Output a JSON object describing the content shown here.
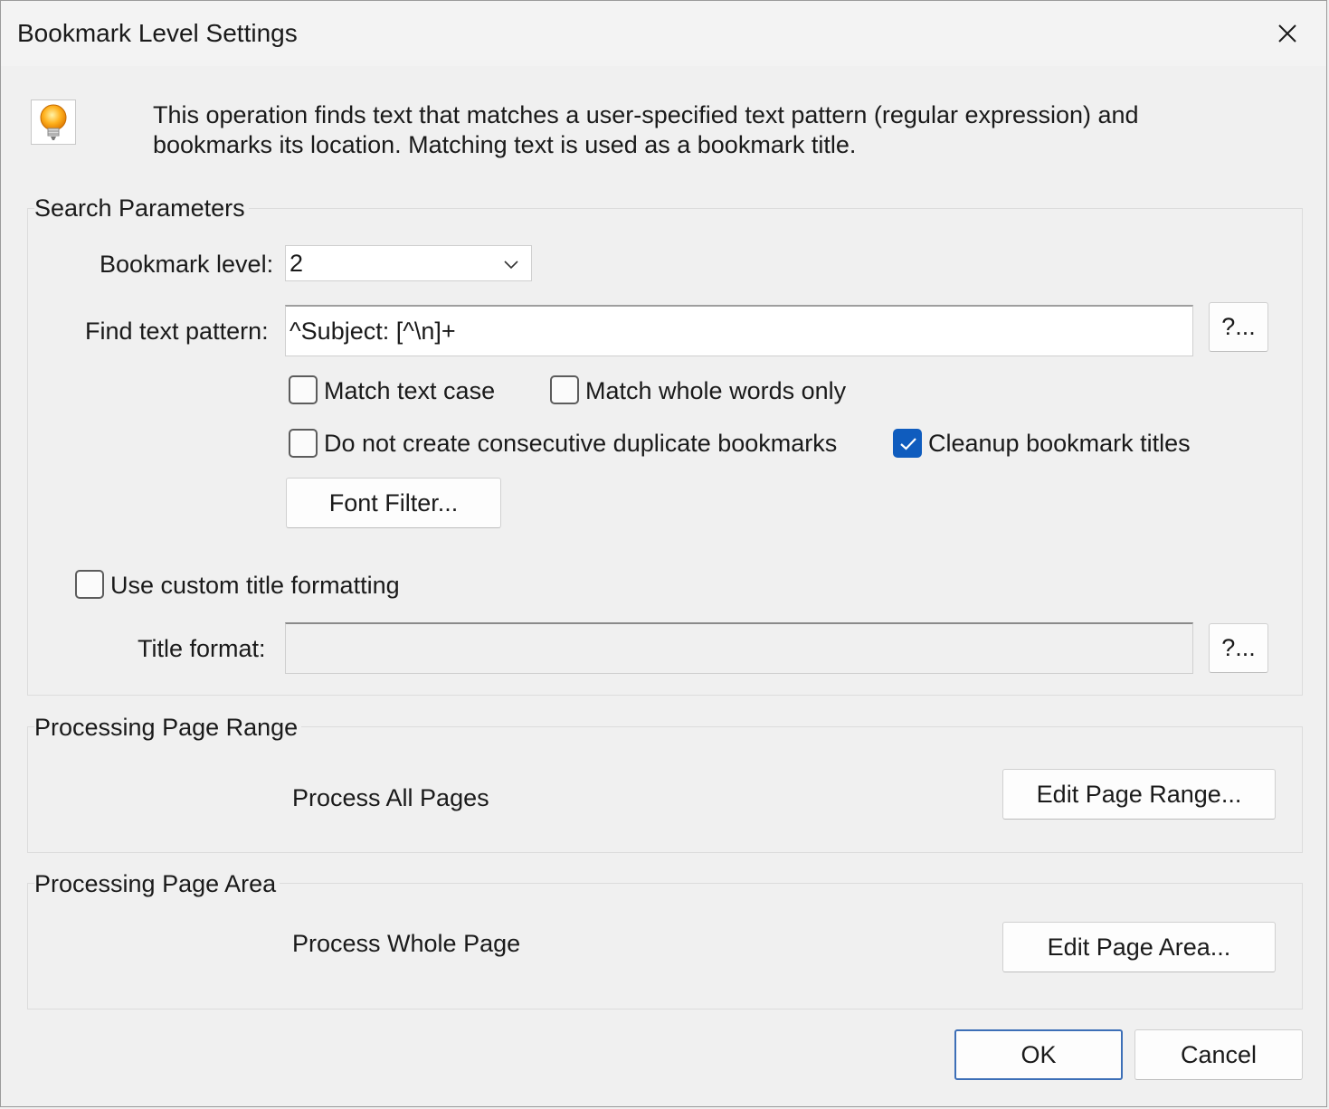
{
  "window": {
    "title": "Bookmark Level Settings",
    "close_icon": "close-icon"
  },
  "info": {
    "icon": "lightbulb-icon",
    "text": "This operation finds text that matches a user-specified text pattern (regular expression) and bookmarks its location. Matching text is used as a bookmark title."
  },
  "search": {
    "group_title": "Search Parameters",
    "level_label": "Bookmark level:",
    "level_value": "2",
    "pattern_label": "Find text pattern:",
    "pattern_value": "^Subject: [^\\n]+",
    "pattern_help": "?...",
    "match_case": {
      "label": "Match text case",
      "checked": false
    },
    "whole_words": {
      "label": "Match whole words only",
      "checked": false
    },
    "no_duplicates": {
      "label": "Do not create consecutive duplicate bookmarks",
      "checked": false
    },
    "cleanup": {
      "label": "Cleanup bookmark titles",
      "checked": true
    },
    "font_filter": "Font Filter...",
    "custom_format": {
      "label": "Use custom title formatting",
      "checked": false
    },
    "title_format_label": "Title format:",
    "title_format_value": "",
    "title_format_help": "?..."
  },
  "range": {
    "group_title": "Processing Page Range",
    "value": "Process All Pages",
    "button": "Edit Page Range..."
  },
  "area": {
    "group_title": "Processing Page Area",
    "value": "Process Whole Page",
    "button": "Edit Page Area..."
  },
  "footer": {
    "ok": "OK",
    "cancel": "Cancel"
  },
  "colors": {
    "accent": "#0f5cbe",
    "default_button_border": "#3d6fb7"
  }
}
